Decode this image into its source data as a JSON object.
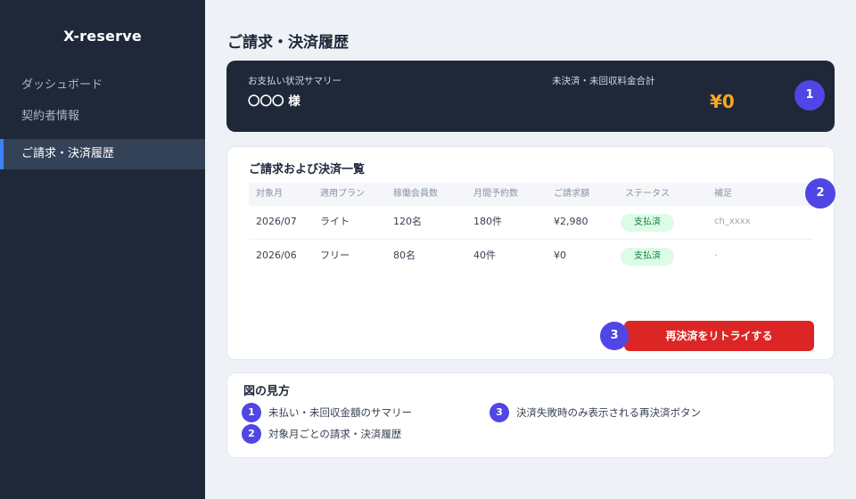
{
  "sidebar": {
    "logo": "X-reserve",
    "items": [
      {
        "label": "ダッシュボード"
      },
      {
        "label": "契約者情報"
      },
      {
        "label": "ご請求・決済履歴"
      }
    ]
  },
  "page": {
    "title": "ご請求・決済履歴"
  },
  "summary": {
    "status_label": "お支払い状況サマリー",
    "customer_name": "〇〇〇 様",
    "unpaid_label": "未決済・未回収料金合計",
    "unpaid_amount": "¥0"
  },
  "markers": [
    "1",
    "2",
    "3"
  ],
  "billing": {
    "title": "ご請求および決済一覧",
    "columns": [
      "対象月",
      "適用プラン",
      "稼働会員数",
      "月間予約数",
      "ご請求額",
      "ステータス",
      "補足"
    ],
    "rows": [
      {
        "month": "2026/07",
        "plan": "ライト",
        "members": "120名",
        "reservations": "180件",
        "amount": "¥2,980",
        "status": "支払済",
        "note": "ch_xxxx"
      },
      {
        "month": "2026/06",
        "plan": "フリー",
        "members": "80名",
        "reservations": "40件",
        "amount": "¥0",
        "status": "支払済",
        "note": "-"
      }
    ],
    "retry_button": "再決済をリトライする"
  },
  "legend": {
    "title": "図の見方",
    "items": [
      {
        "num": "1",
        "text": "未払い・未回収金額のサマリー"
      },
      {
        "num": "2",
        "text": "対象月ごとの請求・決済履歴"
      },
      {
        "num": "3",
        "text": "決済失敗時のみ表示される再決済ボタン"
      }
    ]
  },
  "colors": {
    "sidebar_bg": "#1e2839",
    "accent": "#4f46e5",
    "danger": "#dc2626",
    "amount": "#f5a623",
    "paid_badge": "#dcfce7"
  }
}
